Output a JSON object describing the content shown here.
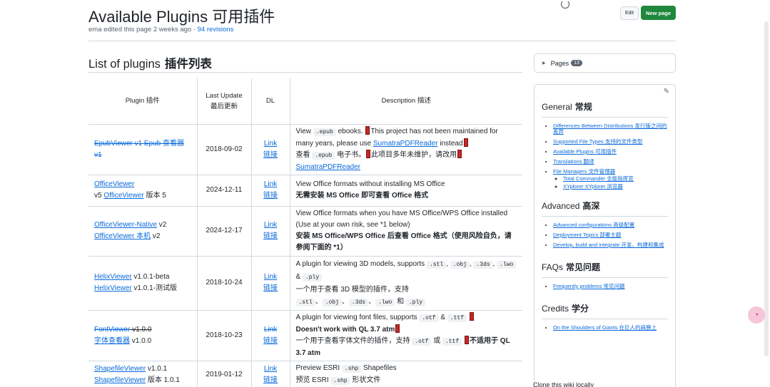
{
  "header": {
    "title": "Available Plugins  可用插件",
    "meta_text": "ema edited this page 2 weeks ago · ",
    "revisions_link": "94 revisions",
    "edit_label": "Edit",
    "new_page_label": "New page"
  },
  "section": {
    "title": "List of plugins",
    "title_cn": "插件列表"
  },
  "table": {
    "headers": {
      "plugin": "Plugin  插件",
      "last_update": "Last Update  最后更新",
      "dl": "DL",
      "description": "Description  描述"
    },
    "rows": [
      {
        "name_link": "EpubViewer v1  Epub 查看器 v1",
        "date": "2018-09-02",
        "dl_en": "Link",
        "dl_cn": "链接",
        "desc_1": "View ",
        "desc_code_1": ".epub",
        "desc_2": " ebooks. ",
        "desc_3": "This project has not been maintained for many years, please use ",
        "desc_link": "SumatraPDFReader",
        "desc_4": " instead",
        "desc_cn_1": "查看 ",
        "desc_cn_code": ".epub",
        "desc_cn_2": " 电子书。",
        "desc_cn_3": "此项目多年未维护，请改用",
        "desc_cn_link": "SumatraPDFReader"
      },
      {
        "name_link": "OfficeViewer",
        "name_rest": "v5  ",
        "name_link2": "OfficeViewer",
        "name_rest2": " 版本 5",
        "date": "2024-12-11",
        "dl_en": "Link",
        "dl_cn": "链接",
        "desc_1": "View Office formats without installing MS Office",
        "desc_cn": "无需安装 MS Office 即可查看 Office 格式"
      },
      {
        "name_link": "OfficeViewer-Native",
        "name_rest": " v2",
        "name_link2": "OfficeViewer 本机",
        "name_rest2": " v2",
        "date": "2024-12-17",
        "dl_en": "Link",
        "dl_cn": "链接",
        "desc_1": "View Office formats when you have MS Office/WPS Office installed (Use at your own risk, see *1 below)",
        "desc_cn": "安装 MS Office/WPS Office 后查看 Office 格式（使用风险自负，请参阅下面的 *1）"
      },
      {
        "name_link": "HelixViewer",
        "name_rest": " v1.0.1-beta",
        "name_link2": "HelixViewer",
        "name_rest2": " v1.0.1-测试版",
        "date": "2018-10-24",
        "dl_en": "Link",
        "dl_cn": "链接",
        "desc_1": "A plugin for viewing 3D models, supports ",
        "codes": [
          ".stl",
          ".obj",
          ".3ds",
          ".lwo",
          ".ply"
        ],
        "desc_cn_1": "一个用于查看 3D 模型的插件，支持",
        "desc_cn_and": "和"
      },
      {
        "name_link": "FontViewer",
        "name_rest": " v1.0.0",
        "name_link2": "字体查看器",
        "name_rest2": " v1.0.0",
        "date": "2018-10-23",
        "dl_en": "Link",
        "dl_cn": "链接",
        "desc_1": "A plugin for viewing font files, supports ",
        "code_a": ".otf",
        "code_b": ".ttf",
        "desc_bold": "Doesn't work with QL 3.7 atm",
        "desc_cn_1": "一个用于查看字体文件的插件，支持 ",
        "desc_cn_or": " 或 ",
        "desc_cn_bold": "不适用于 QL 3.7 atm"
      },
      {
        "name_link": "ShapefileViewer",
        "name_rest": " v1.0.1",
        "name_link2": "ShapefileViewer",
        "name_rest2": " 版本 1.0.1",
        "date": "2019-01-12",
        "dl_en": "Link",
        "dl_cn": "链接",
        "desc_1": "Preview ESRI ",
        "code": ".shp",
        "desc_2": " Shapefiles",
        "desc_cn_1": "预览 ESRI ",
        "desc_cn_2": " 形状文件"
      }
    ]
  },
  "sidebar": {
    "pages_label": "Pages",
    "pages_count": "13",
    "general_title": "General",
    "general_cn": "常规",
    "general_items": [
      "Differences Between Distributions  发行版之间的差异",
      "Supported File Types  支持的文件类型",
      "Available Plugins  可用插件",
      "Translations  翻译",
      "File Managers  文件管理器"
    ],
    "file_manager_sub": [
      "Total Commander  全能指挥官",
      "XYplorer  XYplorer 浏览器"
    ],
    "advanced_title": "Advanced",
    "advanced_cn": "高深",
    "advanced_items": [
      "Advanced configurations  高级配置",
      "Deployment Topics  部署主题",
      "Develop, build and integrate  开发、构建和集成"
    ],
    "faqs_title": "FAQs",
    "faqs_cn": "常见问题",
    "faqs_items": [
      "Frequently problems  常见问题"
    ],
    "credits_title": "Credits",
    "credits_cn": "学分",
    "credits_items": [
      "On the Shoulders of Giants  在巨人的肩膀上"
    ],
    "clone_text": "Clone this wiki locally"
  },
  "colors": {
    "link": "#0969da",
    "primary_button": "#1f883d",
    "border": "#d1d9e0",
    "flag": "#c62828"
  },
  "icons": [
    "pencil-icon",
    "triangle-right-icon",
    "red-flag-icon",
    "loading-cursor-icon"
  ]
}
